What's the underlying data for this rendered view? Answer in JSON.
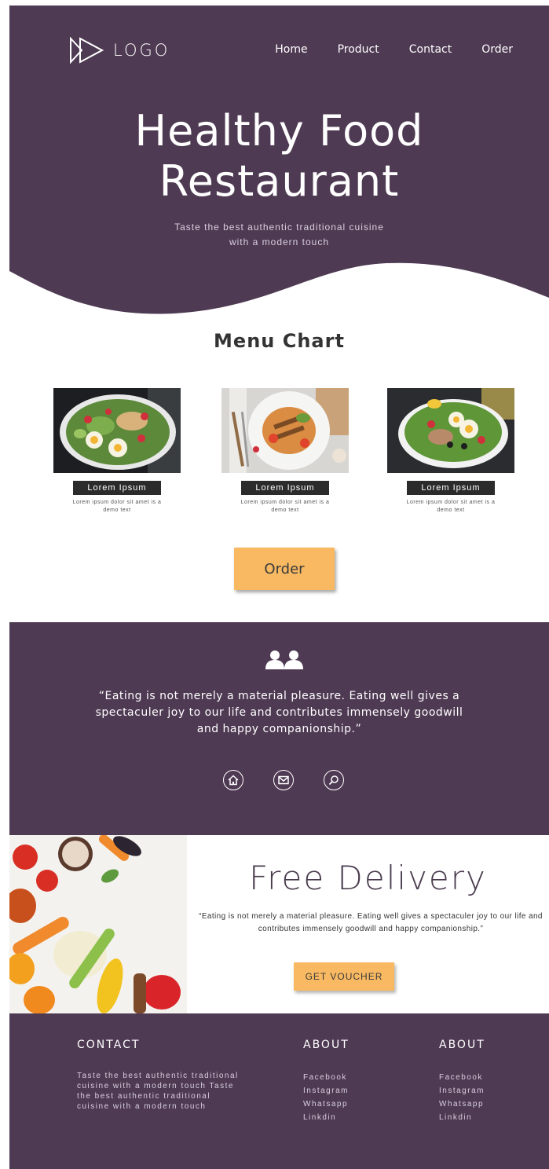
{
  "header": {
    "logo_text": "LOGO",
    "nav": [
      "Home",
      "Product",
      "Contact",
      "Order"
    ]
  },
  "hero": {
    "title_line1": "Healthy Food",
    "title_line2": "Restaurant",
    "subtitle_line1": "Taste the best authentic traditional cuisine",
    "subtitle_line2": "with a modern touch"
  },
  "menu": {
    "title": "Menu Chart",
    "cards": [
      {
        "label": "Lorem Ipsum",
        "desc": "Lorem ipsum dolor sit amet is a demo text"
      },
      {
        "label": "Lorem Ipsum",
        "desc": "Lorem ipsum dolor sit amet is a demo text"
      },
      {
        "label": "Lorem Ipsum",
        "desc": "Lorem ipsum dolor sit amet is a demo text"
      }
    ],
    "order_label": "Order"
  },
  "quote": {
    "text": "“Eating is not merely a material pleasure. Eating well gives a spectaculer joy to our life and contributes immensely goodwill and happy companionship.”",
    "icons": [
      "home-icon",
      "mail-icon",
      "search-icon"
    ]
  },
  "delivery": {
    "title": "Free Delivery",
    "text": "“Eating is not merely a material pleasure. Eating well gives a spectaculer joy to our life and contributes immensely goodwill and happy companionship.”",
    "button_label": "GET VOUCHER"
  },
  "footer": {
    "contact_title": "CONTACT",
    "contact_text": "Taste the best authentic traditional cuisine with a modern touch Taste the best authentic traditional cuisine with a modern touch",
    "about1_title": "ABOUT",
    "about1_links": [
      "Facebook",
      "Instagram",
      "Whatsapp",
      "Linkdin"
    ],
    "about2_title": "ABOUT",
    "about2_links": [
      "Facebook",
      "Instagram",
      "Whatsapp",
      "Linkdin"
    ]
  },
  "colors": {
    "primary": "#4f3a53",
    "accent": "#f8b962"
  }
}
